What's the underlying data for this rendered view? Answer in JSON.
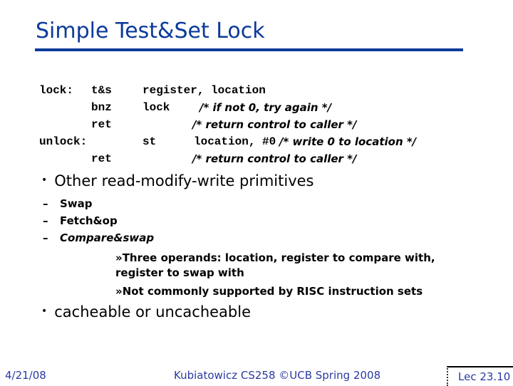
{
  "slide": {
    "title": "Simple Test&Set Lock",
    "code": {
      "lines": [
        {
          "label": "lock:",
          "op": "t&s",
          "args": "register, location",
          "comment": ""
        },
        {
          "label": "",
          "op": "bnz",
          "args": "lock",
          "comment": "/* if not 0, try again */"
        },
        {
          "label": "",
          "op": "ret",
          "args": "",
          "comment": "/* return control to caller */"
        },
        {
          "label": "unlock:",
          "op": "st",
          "args": "location, #0",
          "comment": "/* write 0 to location */"
        },
        {
          "label": "",
          "op": "ret",
          "args": "",
          "comment": "/* return control to caller */"
        }
      ]
    },
    "bullets": [
      {
        "text": "Other read-modify-write primitives",
        "subitems": [
          {
            "text": "Swap"
          },
          {
            "text": "Fetch&op"
          },
          {
            "text": "Compare&swap",
            "details": [
              "»Three operands: location, register to compare with,",
              "register to swap with",
              "»Not commonly supported by RISC instruction sets"
            ]
          }
        ]
      },
      {
        "text": "cacheable or uncacheable"
      }
    ],
    "bullet_glyph": "•",
    "dash_glyph": "–"
  },
  "footer": {
    "date": "4/21/08",
    "center": "Kubiatowicz CS258 ©UCB Spring 2008",
    "page": "Lec 23.10"
  },
  "colors": {
    "title": "#0b3a9a",
    "footer": "#2b3aa0"
  }
}
